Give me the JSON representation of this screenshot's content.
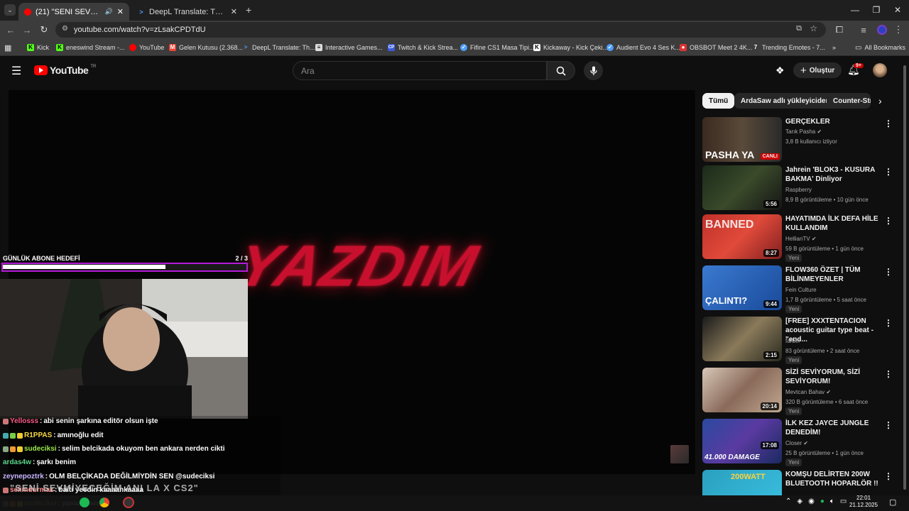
{
  "browser": {
    "tabs": [
      {
        "title": "(21) \"SENI SEVMIYECEĞIM A",
        "active": true
      },
      {
        "title": "DeepL Translate: The world's m",
        "active": false
      }
    ],
    "url": "youtube.com/watch?v=zLsakCPDTdU",
    "bookmarks": [
      "Kick",
      "eneswind Stream -...",
      "YouTube",
      "Gelen Kutusu (2.368...",
      "DeepL Translate: Th...",
      "Interactive Games...",
      "Twitch & Kick Strea...",
      "Fifine CS1 Masa Tipi...",
      "Kickaway - Kick Çeki...",
      "Audient Evo 4 Ses K...",
      "OBSBOT Meet 2 4K...",
      "Trending Emotes - 7..."
    ],
    "all_bookmarks": "All Bookmarks"
  },
  "youtube": {
    "logo": "YouTube",
    "logo_sup": "TR",
    "search_placeholder": "Ara",
    "create_label": "Oluştur",
    "notif_badge": "9+"
  },
  "player": {
    "video_text": "YAZDIM",
    "goal_label": "GÜNLÜK ABONE HEDEFİ",
    "goal_count": "2 / 3",
    "goal_progress": 0.667,
    "now_playing": "\"SENİ SEVMİYECEĞİM ANI LA X CS2\""
  },
  "chat": [
    {
      "user": "Yellosss",
      "color": "#ff5a8a",
      "msg": "abi senin şarkına editör olsun işte"
    },
    {
      "user": "R1PPAS",
      "color": "#f5d742",
      "msg": "amınoğlu edit"
    },
    {
      "user": "sudeciksi",
      "color": "#9be84a",
      "msg": "selim belcikada okuyom ben ankara nerden cikti"
    },
    {
      "user": "ardas4w",
      "color": "#59d68a",
      "msg": "şarkı benim"
    },
    {
      "user": "zeynepoztrk",
      "color": "#c7b3ff",
      "msg": "OLM BELÇİKADA DEĞİLMİYDİN SEN @sudeciksi"
    },
    {
      "user": "selimdurmaz",
      "color": "#ff8c8c",
      "msg": "baiti yeedin kaaaankaaaa"
    },
    {
      "user": "sudeciksi",
      "color": "#9be84a",
      "msg": "yaaaaaaaaa"
    }
  ],
  "chips": [
    "Tümü",
    "ArdaSaw adlı yükleyiciden",
    "Counter-Str"
  ],
  "videos": [
    {
      "title": "GERÇEKLER",
      "channel": "Tarık Pasha",
      "verified": true,
      "meta": "3,8 B kullanıcı izliyor",
      "badge": "CANLI",
      "thumb_text": "PASHA YA",
      "yeni": false
    },
    {
      "title": "Jahrein 'BLOK3 - KUSURA BAKMA' Dinliyor",
      "channel": "Raspberry",
      "verified": false,
      "meta": "8,9 B görüntüleme • 10 gün önce",
      "duration": "5:56",
      "yeni": false
    },
    {
      "title": "HAYATIMDA İLK DEFA HİLE KULLANDIM",
      "channel": "HellianTV",
      "verified": true,
      "meta": "59 B görüntüleme • 1 gün önce",
      "duration": "8:27",
      "thumb_text": "BANNED",
      "yeni": true
    },
    {
      "title": "FLOW360 ÖZET | TÜM BİLİNMEYENLER",
      "channel": "Fein Culture",
      "verified": false,
      "meta": "1,7 B görüntüleme • 5 saat önce",
      "duration": "9:44",
      "thumb_text": "ÇALINTI?",
      "yeni": true
    },
    {
      "title": "[FREE] XXXTENTACION acoustic guitar type beat -\"end...",
      "channel": "farber",
      "verified": false,
      "meta": "83 görüntüleme • 2 saat önce",
      "duration": "2:15",
      "yeni": true
    },
    {
      "title": "SİZİ SEVİYORUM, SİZİ SEVİYORUM!",
      "channel": "Mevtcan Bahav",
      "verified": true,
      "meta": "320 B görüntüleme • 6 saat önce",
      "duration": "20:14",
      "yeni": true
    },
    {
      "title": "İLK KEZ JAYCE JUNGLE DENEDİM!",
      "channel": "Closer",
      "verified": true,
      "meta": "25 B görüntüleme • 1 gün önce",
      "duration": "17:08",
      "thumb_text": "41.000 DAMAGE",
      "yeni": true
    },
    {
      "title": "KOMŞU DELİRTEN 200W BLUETOOTH HOPARLÖR !!",
      "channel": "",
      "verified": false,
      "meta": "",
      "thumb_text": "200WATT",
      "yeni": false
    }
  ],
  "taskbar": {
    "time": "22:01",
    "date": "21.12.2025"
  }
}
